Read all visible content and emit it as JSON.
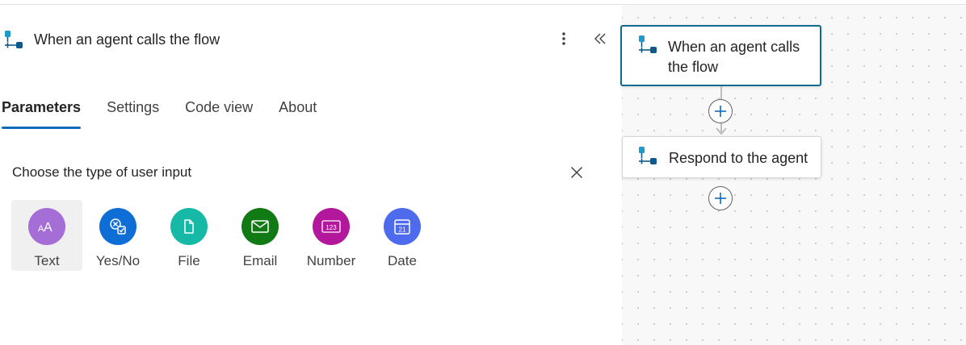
{
  "panel": {
    "title": "When an agent calls the flow",
    "tabs": [
      {
        "label": "Parameters",
        "active": true
      },
      {
        "label": "Settings",
        "active": false
      },
      {
        "label": "Code view",
        "active": false
      },
      {
        "label": "About",
        "active": false
      }
    ],
    "input_chooser": {
      "title": "Choose the type of user input",
      "types": [
        {
          "label": "Text",
          "icon": "text-aa-icon",
          "color": "#a56dd6",
          "selected": true
        },
        {
          "label": "Yes/No",
          "icon": "yes-no-icon",
          "color": "#0f6ed6",
          "selected": false
        },
        {
          "label": "File",
          "icon": "file-icon",
          "color": "#16b8a6",
          "selected": false
        },
        {
          "label": "Email",
          "icon": "email-icon",
          "color": "#117a14",
          "selected": false
        },
        {
          "label": "Number",
          "icon": "number-123-icon",
          "color": "#b3179b",
          "selected": false
        },
        {
          "label": "Date",
          "icon": "calendar-icon",
          "color": "#4f6bed",
          "selected": false
        }
      ]
    }
  },
  "canvas": {
    "nodes": [
      {
        "line1": "When an agent calls",
        "line2": "the flow",
        "selected": true
      },
      {
        "line1": "Respond to the agent",
        "selected": false
      }
    ]
  },
  "colors": {
    "accent": "#0f6cbd",
    "flow_icon_teal": "#1e9bc7",
    "flow_icon_navy": "#0f5a8a"
  }
}
